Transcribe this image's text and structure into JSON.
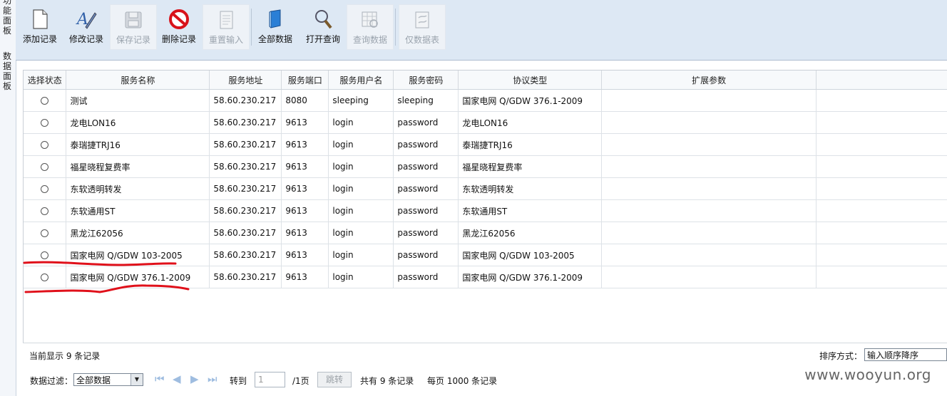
{
  "side_tabs": [
    "功能面板",
    "数据面板"
  ],
  "toolbar": [
    {
      "label": "添加记录",
      "icon": "document-icon",
      "enabled": true
    },
    {
      "label": "修改记录",
      "icon": "edit-pen-icon",
      "enabled": true
    },
    {
      "label": "保存记录",
      "icon": "save-disk-icon",
      "enabled": false
    },
    {
      "label": "删除记录",
      "icon": "delete-icon",
      "enabled": true
    },
    {
      "label": "重置输入",
      "icon": "reset-icon",
      "enabled": false
    },
    {
      "label": "全部数据",
      "icon": "book-icon",
      "enabled": true
    },
    {
      "label": "打开查询",
      "icon": "magnifier-icon",
      "enabled": true
    },
    {
      "label": "查询数据",
      "icon": "table-search-icon",
      "enabled": false
    },
    {
      "label": "仅数据表",
      "icon": "data-table-icon",
      "enabled": false
    }
  ],
  "table": {
    "headers": [
      "选择状态",
      "服务名称",
      "服务地址",
      "服务端口",
      "服务用户名",
      "服务密码",
      "协议类型",
      "扩展参数"
    ],
    "rows": [
      [
        "测试",
        "58.60.230.217",
        "8080",
        "sleeping",
        "sleeping",
        "国家电网 Q/GDW 376.1-2009",
        ""
      ],
      [
        "龙电LON16",
        "58.60.230.217",
        "9613",
        "login",
        "password",
        "龙电LON16",
        ""
      ],
      [
        "泰瑞捷TRJ16",
        "58.60.230.217",
        "9613",
        "login",
        "password",
        "泰瑞捷TRJ16",
        ""
      ],
      [
        "福星晓程复费率",
        "58.60.230.217",
        "9613",
        "login",
        "password",
        "福星晓程复费率",
        ""
      ],
      [
        "东软透明转发",
        "58.60.230.217",
        "9613",
        "login",
        "password",
        "东软透明转发",
        ""
      ],
      [
        "东软通用ST",
        "58.60.230.217",
        "9613",
        "login",
        "password",
        "东软通用ST",
        ""
      ],
      [
        "黑龙江62056",
        "58.60.230.217",
        "9613",
        "login",
        "password",
        "黑龙江62056",
        ""
      ],
      [
        "国家电网 Q/GDW 103-2005",
        "58.60.230.217",
        "9613",
        "login",
        "password",
        "国家电网 Q/GDW 103-2005",
        ""
      ],
      [
        "国家电网 Q/GDW 376.1-2009",
        "58.60.230.217",
        "9613",
        "login",
        "password",
        "国家电网 Q/GDW 376.1-2009",
        ""
      ]
    ]
  },
  "status": {
    "record_info": "当前显示 9 条记录",
    "sort_label": "排序方式：",
    "sort_value": "输入顺序降序"
  },
  "pager": {
    "filter_label": "数据过滤：",
    "filter_value": "全部数据",
    "goto_label": "转到",
    "page_input_placeholder": "1",
    "page_total": "/1页",
    "jump_button": "跳转",
    "total_records": "共有 9 条记录",
    "per_page": "每页 1000 条记录"
  },
  "watermark": "www.wooyun.org",
  "colors": {
    "toolbar_bg": "#dde8f4",
    "annotation": "#e0101a",
    "nav_arrows": "#9fbde0"
  }
}
